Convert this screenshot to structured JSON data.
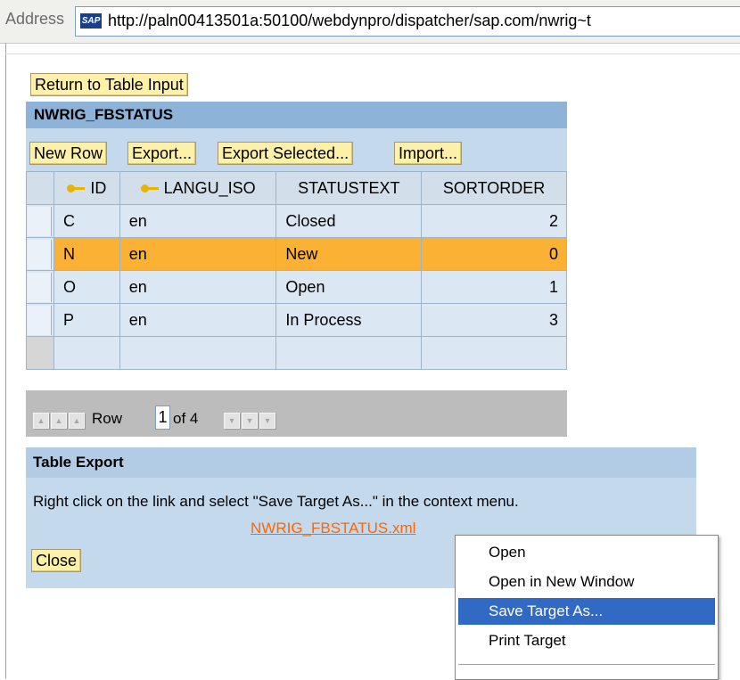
{
  "address_bar": {
    "label": "Address",
    "icon": "sap-icon",
    "url": "http://paln00413501a:50100/webdynpro/dispatcher/sap.com/nwrig~t"
  },
  "return_button": "Return to Table Input",
  "table": {
    "title": "NWRIG_FBSTATUS",
    "toolbar": [
      "New Row",
      "Export...",
      "Export Selected...",
      "Import..."
    ],
    "columns": [
      "ID",
      "LANGU_ISO",
      "STATUSTEXT",
      "SORTORDER"
    ],
    "rows": [
      {
        "id": "C",
        "langu": "en",
        "status": "Closed",
        "sort": "2"
      },
      {
        "id": "N",
        "langu": "en",
        "status": "New",
        "sort": "0"
      },
      {
        "id": "O",
        "langu": "en",
        "status": "Open",
        "sort": "1"
      },
      {
        "id": "P",
        "langu": "en",
        "status": "In Process",
        "sort": "3"
      }
    ],
    "pager": {
      "row_label": "Row",
      "current": "1",
      "of_label": "of 4"
    }
  },
  "export": {
    "title": "Table Export",
    "instruction": "Right click on the link and select \"Save Target As...\" in the context menu.",
    "link": "NWRIG_FBSTATUS.xml",
    "close": "Close"
  },
  "context_menu": {
    "items": [
      "Open",
      "Open in New Window",
      "Save Target As...",
      "Print Target"
    ],
    "active": "Save Target As..."
  },
  "colors": {
    "highlight_row": "#fbb234",
    "button_bg": "#fdf0a9",
    "link": "#ff6600",
    "menu_active": "#316ac5"
  }
}
